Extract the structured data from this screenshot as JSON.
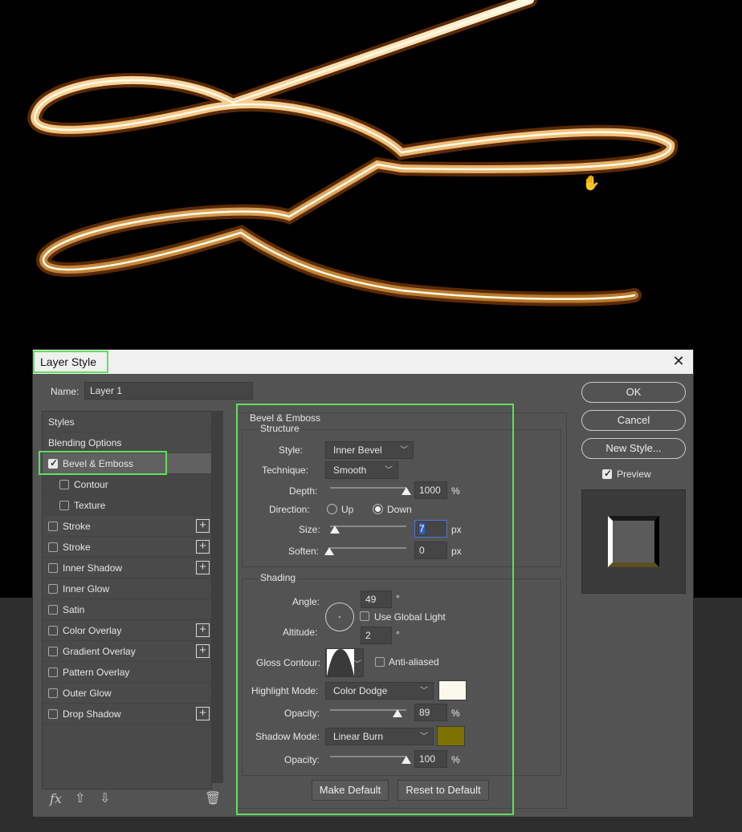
{
  "dialog": {
    "title": "Layer Style",
    "close_icon": "close-icon"
  },
  "name_field": {
    "label": "Name:",
    "value": "Layer 1"
  },
  "left_list": {
    "styles_header": "Styles",
    "blending_options": "Blending Options",
    "items": [
      {
        "label": "Bevel & Emboss",
        "checked": true,
        "plus": false
      },
      {
        "label": "Contour",
        "checked": false,
        "plus": false
      },
      {
        "label": "Texture",
        "checked": false,
        "plus": false
      },
      {
        "label": "Stroke",
        "checked": false,
        "plus": true
      },
      {
        "label": "Stroke",
        "checked": false,
        "plus": true
      },
      {
        "label": "Inner Shadow",
        "checked": false,
        "plus": true
      },
      {
        "label": "Inner Glow",
        "checked": false,
        "plus": false
      },
      {
        "label": "Satin",
        "checked": false,
        "plus": false
      },
      {
        "label": "Color Overlay",
        "checked": false,
        "plus": true
      },
      {
        "label": "Gradient Overlay",
        "checked": false,
        "plus": true
      },
      {
        "label": "Pattern Overlay",
        "checked": false,
        "plus": false
      },
      {
        "label": "Outer Glow",
        "checked": false,
        "plus": false
      },
      {
        "label": "Drop Shadow",
        "checked": false,
        "plus": true
      }
    ],
    "footer": {
      "fx": "fx",
      "up_icon": "arrow-up-icon",
      "down_icon": "arrow-down-icon",
      "trash_icon": "trash-icon"
    }
  },
  "bevel": {
    "section_title": "Bevel & Emboss",
    "structure_title": "Structure",
    "style_label": "Style:",
    "style_value": "Inner Bevel",
    "technique_label": "Technique:",
    "technique_value": "Smooth",
    "depth_label": "Depth:",
    "depth_value": "1000",
    "depth_unit": "%",
    "direction_label": "Direction:",
    "direction_up": "Up",
    "direction_down": "Down",
    "direction_selected": "Down",
    "size_label": "Size:",
    "size_value": "7",
    "size_unit": "px",
    "soften_label": "Soften:",
    "soften_value": "0",
    "soften_unit": "px",
    "shading_title": "Shading",
    "angle_label": "Angle:",
    "angle_value": "49",
    "angle_unit": "°",
    "use_global_light": "Use Global Light",
    "altitude_label": "Altitude:",
    "altitude_value": "2",
    "altitude_unit": "°",
    "gloss_contour_label": "Gloss Contour:",
    "anti_aliased": "Anti-aliased",
    "highlight_mode_label": "Highlight Mode:",
    "highlight_mode_value": "Color Dodge",
    "highlight_color": "#fbf9ec",
    "highlight_opacity_label": "Opacity:",
    "highlight_opacity_value": "89",
    "highlight_opacity_unit": "%",
    "shadow_mode_label": "Shadow Mode:",
    "shadow_mode_value": "Linear Burn",
    "shadow_color": "#7d7200",
    "shadow_opacity_label": "Opacity:",
    "shadow_opacity_value": "100",
    "shadow_opacity_unit": "%",
    "make_default": "Make Default",
    "reset_default": "Reset to Default"
  },
  "right": {
    "ok": "OK",
    "cancel": "Cancel",
    "new_style": "New Style...",
    "preview_label": "Preview",
    "preview_checked": true
  },
  "colors": {
    "highlight_outline": "#5fe15a",
    "dialog_bg": "#535353",
    "gold": "#e8b060"
  }
}
